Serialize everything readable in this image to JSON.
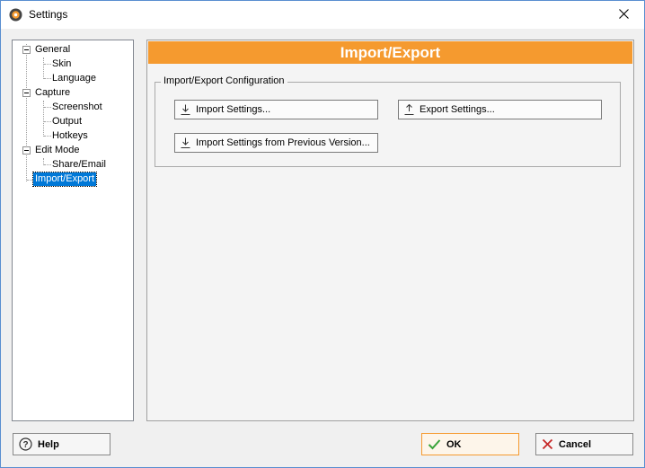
{
  "window": {
    "title": "Settings"
  },
  "tree": {
    "items": [
      {
        "label": "General"
      },
      {
        "label": "Skin"
      },
      {
        "label": "Language"
      },
      {
        "label": "Capture"
      },
      {
        "label": "Screenshot"
      },
      {
        "label": "Output"
      },
      {
        "label": "Hotkeys"
      },
      {
        "label": "Edit Mode"
      },
      {
        "label": "Share/Email"
      },
      {
        "label": "Import/Export"
      }
    ],
    "selected": "Import/Export"
  },
  "content": {
    "header": "Import/Export",
    "group_title": "Import/Export Configuration",
    "buttons": {
      "import": "Import Settings...",
      "export": "Export Settings...",
      "import_prev": "Import Settings from Previous Version..."
    }
  },
  "footer": {
    "help": "Help",
    "ok": "OK",
    "cancel": "Cancel"
  },
  "colors": {
    "header_bg": "#f59a2f",
    "selection": "#0078d7",
    "ok_check": "#3aa33a",
    "cancel_x": "#c62828"
  }
}
